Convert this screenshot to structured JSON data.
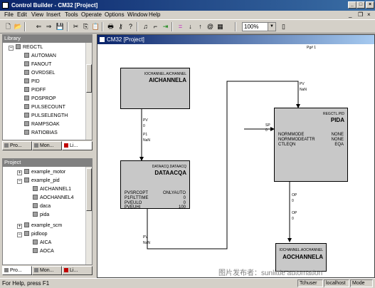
{
  "window": {
    "title": "Control Builder - CM32 [Project]",
    "buttons": [
      "_",
      "□",
      "×"
    ]
  },
  "menu": [
    "File",
    "Edit",
    "View",
    "Insert",
    "Tools",
    "Operate",
    "Options",
    "Window",
    "Help"
  ],
  "toolbar": {
    "zoom": "100%"
  },
  "library": {
    "title": "Library",
    "items": [
      "REGCTL",
      "AUTOMAN",
      "FANOUT",
      "OVRDSEL",
      "PID",
      "PIDFF",
      "POSPROP",
      "PULSECOUNT",
      "PULSELENGTH",
      "RAMPSOAK",
      "RATIOBIAS"
    ],
    "tabs": [
      "Pro...",
      "Mon...",
      "Li..."
    ]
  },
  "project": {
    "title": "Project",
    "items": [
      "example_motor",
      "example_pid",
      "AICHANNEL1",
      "AOCHANNEL4",
      "daca",
      "pida",
      "example_scm",
      "pidloop",
      "AICA",
      "AOCA"
    ],
    "tabs": [
      "Pro...",
      "Mon...",
      "Li..."
    ]
  },
  "editor": {
    "title": "CM32 [Project]",
    "page_label": "Pg# 1",
    "blocks": {
      "aichannel": {
        "type": "IOCHANNEL.AICHANNEL",
        "name": "AICHANNELA"
      },
      "datacqa": {
        "type": "DATAACQ.DATAACQ",
        "name": "DATAACQA",
        "params": [
          {
            "k": "PVSRCOPT",
            "v": "ONLYAUTO"
          },
          {
            "k": "P1FILTTIME",
            "v": "0"
          },
          {
            "k": "PVEULO",
            "v": "0"
          },
          {
            "k": "PVEUHI",
            "v": "100"
          }
        ]
      },
      "pida": {
        "type": "REGCTL.PID",
        "name": "PIDA",
        "params": [
          {
            "k": "NORMMODE",
            "v": "NONE"
          },
          {
            "k": "NORMMODEATTR",
            "v": "NONE"
          },
          {
            "k": "CTLEQN",
            "v": "EQA"
          }
        ]
      },
      "aochannel": {
        "type": "IOCHANNEL.AOCHANNEL",
        "name": "AOCHANNELA"
      }
    },
    "pins": {
      "ai_out": "PV",
      "ai_out_n": "0",
      "ai_out_n2": "NaN",
      "daq_in": "P1",
      "daq_in_n": "NaN",
      "daq_out": "PV",
      "daq_out_n": "NaN",
      "pid_pv": "PV",
      "pid_pv_n": "NaN",
      "pid_sp": "SP",
      "pid_sp_n": "0",
      "pid_op": "OP",
      "pid_op_n": "0",
      "ao_op": "OP",
      "ao_op_n": "0"
    }
  },
  "status": {
    "text": "For Help, press F1",
    "panes": [
      "Tchuser",
      "localhost",
      "Mode"
    ],
    "watermark": "图片发布者：sunlittle automation"
  }
}
